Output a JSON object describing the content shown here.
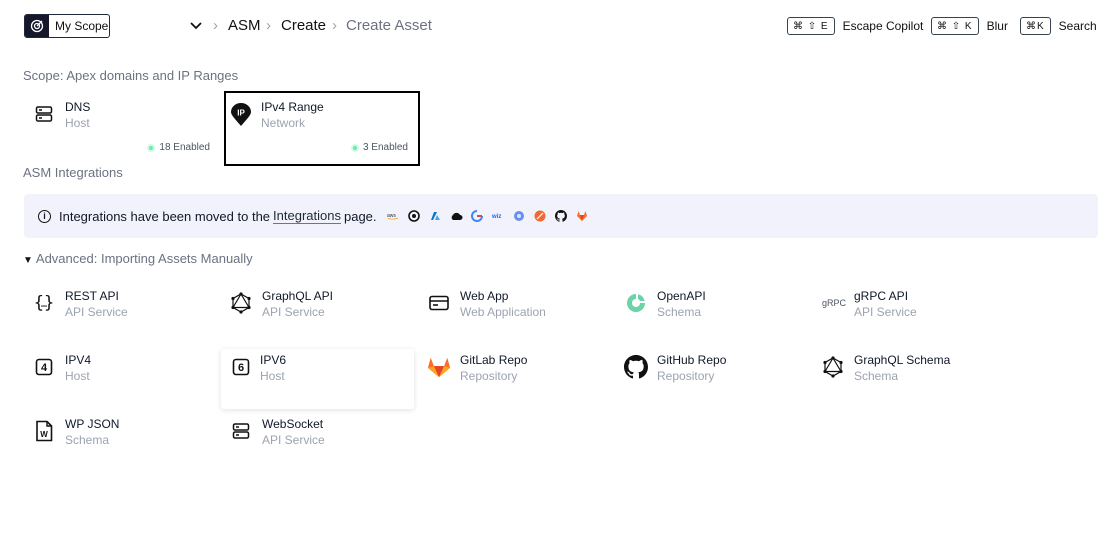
{
  "header": {
    "scope_label": "My Scope",
    "breadcrumbs": [
      "ASM",
      "Create",
      "Create Asset"
    ],
    "shortcuts": [
      {
        "keys": "⌘ ⇧ E",
        "label": "Escape Copilot"
      },
      {
        "keys": "⌘ ⇧ K",
        "label": "Blur"
      },
      {
        "keys": "⌘K",
        "label": "Search"
      }
    ]
  },
  "scope_section": {
    "title": "Scope: Apex domains and IP Ranges",
    "cards": [
      {
        "title": "DNS",
        "subtitle": "Host",
        "badge": "18 Enabled",
        "icon": "server-icon"
      },
      {
        "title": "IPv4 Range",
        "subtitle": "Network",
        "badge": "3 Enabled",
        "icon": "ip-pin-icon"
      }
    ]
  },
  "integrations": {
    "title": "ASM Integrations",
    "banner_prefix": "Integrations have been moved to the",
    "banner_link": "Integrations",
    "banner_suffix": "page.",
    "icons": [
      "aws-icon",
      "openai-icon",
      "azure-icon",
      "gcp-icon",
      "wiz-icon",
      "blue-dot-icon",
      "orange-circle-icon",
      "github-icon",
      "gitlab-icon"
    ]
  },
  "advanced": {
    "title": "Advanced: Importing Assets Manually",
    "cards": [
      {
        "title": "REST API",
        "subtitle": "API Service",
        "icon": "braces-icon"
      },
      {
        "title": "GraphQL API",
        "subtitle": "API Service",
        "icon": "graphql-icon"
      },
      {
        "title": "Web App",
        "subtitle": "Web Application",
        "icon": "browser-window-icon"
      },
      {
        "title": "OpenAPI",
        "subtitle": "Schema",
        "icon": "openapi-icon"
      },
      {
        "title": "gRPC API",
        "subtitle": "API Service",
        "icon": "grpc-icon",
        "icon_text": "gRPC"
      },
      {
        "title": "IPV4",
        "subtitle": "Host",
        "icon": "ipv4-icon",
        "icon_text": "4"
      },
      {
        "title": "IPV6",
        "subtitle": "Host",
        "icon": "ipv6-icon",
        "icon_text": "6"
      },
      {
        "title": "GitLab Repo",
        "subtitle": "Repository",
        "icon": "gitlab-icon"
      },
      {
        "title": "GitHub Repo",
        "subtitle": "Repository",
        "icon": "github-icon"
      },
      {
        "title": "GraphQL Schema",
        "subtitle": "Schema",
        "icon": "graphql-icon"
      },
      {
        "title": "WP JSON",
        "subtitle": "Schema",
        "icon": "wordpress-file-icon",
        "icon_text": "W"
      },
      {
        "title": "WebSocket",
        "subtitle": "API Service",
        "icon": "server-icon"
      }
    ]
  }
}
